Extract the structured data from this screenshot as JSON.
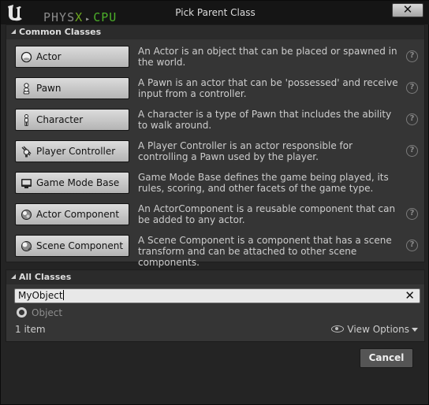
{
  "window": {
    "title": "Pick Parent Class",
    "close_label": "✕",
    "physx": {
      "physx_text": "PHYS",
      "x_text": "X",
      "arrow": "▸",
      "cpu_text": "CPU"
    },
    "colors": {
      "background": "#242424",
      "titlebar": "#151515",
      "section": "#353535",
      "accent_green": "#4caf2a",
      "button_light": "#c8c8c8",
      "button_dark": "#555555"
    }
  },
  "common": {
    "header": "Common Classes",
    "classes": [
      {
        "label": "Actor",
        "icon": "actor-sphere-icon",
        "description": "An Actor is an object that can be placed or spawned in the world."
      },
      {
        "label": "Pawn",
        "icon": "pawn-figure-icon",
        "description": "A Pawn is an actor that can be 'possessed' and receive input from a controller."
      },
      {
        "label": "Character",
        "icon": "character-figure-icon",
        "description": "A character is a type of Pawn that includes the ability to walk around."
      },
      {
        "label": "Player Controller",
        "icon": "player-controller-icon",
        "description": "A Player Controller is an actor responsible for controlling a Pawn used by the player."
      },
      {
        "label": "Game Mode Base",
        "icon": "game-mode-icon",
        "description": "Game Mode Base defines the game being played, its rules, scoring, and other facets of the game type."
      },
      {
        "label": "Actor Component",
        "icon": "actor-component-icon",
        "description": "An ActorComponent is a reusable component that can be added to any actor."
      },
      {
        "label": "Scene Component",
        "icon": "scene-component-icon",
        "description": "A Scene Component is a component that has a scene transform and can be attached to other scene components."
      }
    ],
    "help_glyph": "?"
  },
  "all": {
    "header": "All Classes",
    "search": {
      "value": "MyObject",
      "clear_label": "✕"
    },
    "tree_items": [
      {
        "label": "Object",
        "icon": "object-class-icon"
      }
    ],
    "count_text": "1 item",
    "view_options_label": "View Options"
  },
  "footer": {
    "cancel_label": "Cancel"
  }
}
